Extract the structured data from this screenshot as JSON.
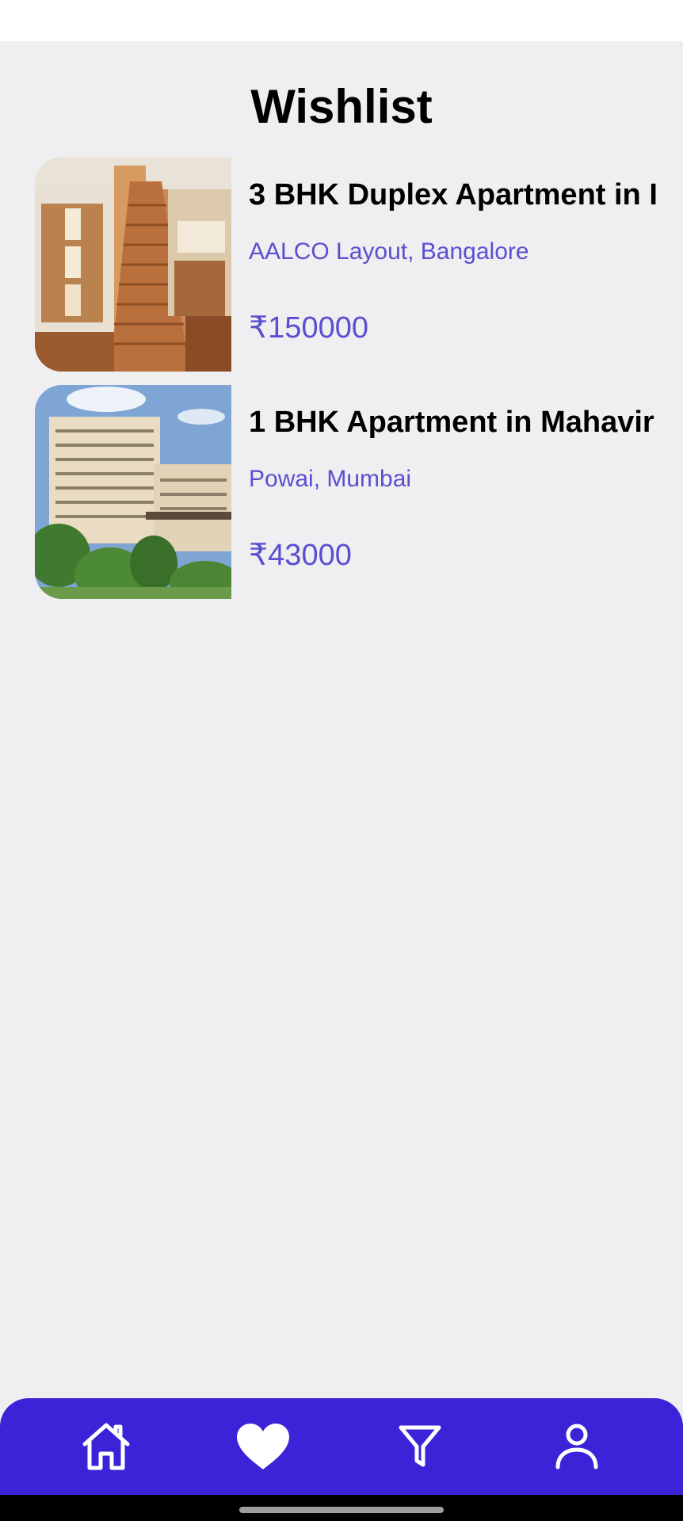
{
  "header": {
    "title": "Wishlist"
  },
  "wishlist": {
    "items": [
      {
        "title": "3 BHK Duplex Apartment in I",
        "location": "AALCO Layout, Bangalore",
        "price": "₹150000",
        "image": "staircase-interior-photo"
      },
      {
        "title": "1 BHK Apartment in Mahavir",
        "location": "Powai, Mumbai",
        "price": "₹43000",
        "image": "hospital-building-photo"
      }
    ]
  },
  "bottom_nav": {
    "items": [
      {
        "icon": "home-icon",
        "active": false
      },
      {
        "icon": "heart-icon",
        "active": true
      },
      {
        "icon": "filter-icon",
        "active": false
      },
      {
        "icon": "user-icon",
        "active": false
      }
    ]
  },
  "colors": {
    "background": "#efeef1",
    "accent": "#3b23d8",
    "secondary_text": "#5a4fd0",
    "title_text": "#000000"
  }
}
